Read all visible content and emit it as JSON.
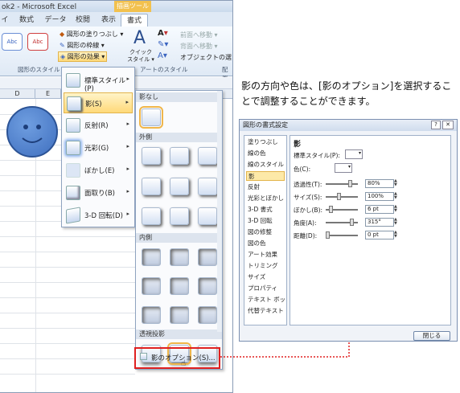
{
  "window": {
    "title": "ok2 - Microsoft Excel",
    "context_tab": "描画ツール"
  },
  "tabs": [
    "イ",
    "数式",
    "データ",
    "校閲",
    "表示",
    "書式"
  ],
  "ribbon": {
    "style_thumb": [
      "Abc",
      "Abc"
    ],
    "fill": "図形の塗りつぶし ▾",
    "outline": "図形の枠線 ▾",
    "effects": "図形の効果 ▾",
    "quick_style": "クイック スタイル ▾",
    "bring_forward": "前面へ移動 ▾",
    "send_backward": "背面へ移動 ▾",
    "selection_pane": "オブジェクトの選",
    "group_shape_styles": "図形のスタイル",
    "group_art_styles": "アートのスタイル",
    "group_arrange": "配置"
  },
  "sheet": {
    "columns": [
      "D",
      "E"
    ]
  },
  "effects_menu": [
    {
      "label": "標準スタイル(P)",
      "arrow": "▸"
    },
    {
      "label": "影(S)",
      "arrow": "▸"
    },
    {
      "label": "反射(R)",
      "arrow": "▸"
    },
    {
      "label": "光彩(G)",
      "arrow": "▸"
    },
    {
      "label": "ぼかし(E)",
      "arrow": "▸"
    },
    {
      "label": "面取り(B)",
      "arrow": "▸"
    },
    {
      "label": "3-D 回転(D)",
      "arrow": "▸"
    }
  ],
  "shadow_gallery": {
    "none": "影なし",
    "outer": "外側",
    "inner": "内側",
    "perspective": "透視投影",
    "options": "影のオプション(S)..."
  },
  "caption": "影の方向や色は、[影のオプション]を選択することで調整することができます。",
  "dialog": {
    "title": "図形の書式設定",
    "categories": [
      "塗りつぶし",
      "線の色",
      "線のスタイル",
      "影",
      "反射",
      "光彩とぼかし",
      "3-D 書式",
      "3-D 回転",
      "図の修整",
      "図の色",
      "アート効果",
      "トリミング",
      "サイズ",
      "プロパティ",
      "テキスト ボックス",
      "代替テキスト"
    ],
    "section": "影",
    "preset_label": "標準スタイル(P):",
    "color_label": "色(C):",
    "transparency_label": "透過性(T):",
    "transparency": "80%",
    "size_label": "サイズ(S):",
    "size": "100%",
    "blur_label": "ぼかし(B):",
    "blur": "6 pt",
    "angle_label": "角度(A):",
    "angle": "315°",
    "distance_label": "距離(D):",
    "distance": "0 pt",
    "close": "閉じる",
    "help": "?",
    "close_x": "✕"
  },
  "colors": {
    "highlight": "#ffd979",
    "red_box": "#e02020",
    "smiley": "#4a78c8"
  }
}
